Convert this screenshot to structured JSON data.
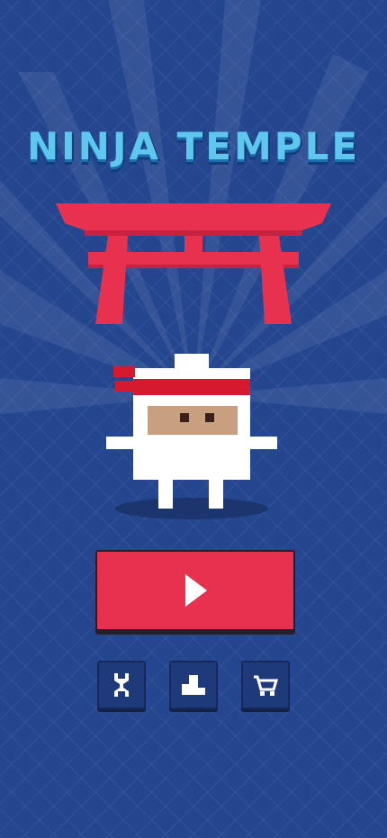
{
  "game": {
    "title": "Ninja Temple"
  },
  "colors": {
    "background": "#24468f",
    "torii": "#e8314f",
    "title": "#5fc6ee",
    "button": "#e8314f",
    "small_button": "#1f3a7a"
  },
  "buttons": {
    "play": {
      "icon": "play-icon"
    },
    "settings": {
      "icon": "wrench-icon"
    },
    "leaderboard": {
      "icon": "podium-icon"
    },
    "shop": {
      "icon": "cart-icon"
    }
  }
}
